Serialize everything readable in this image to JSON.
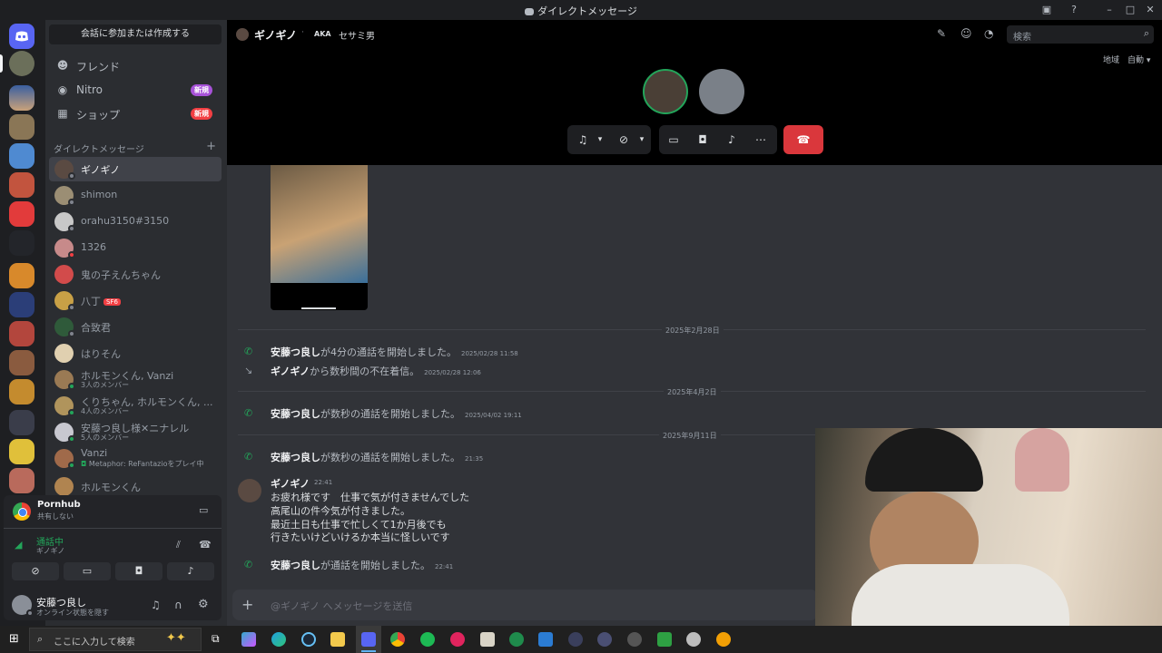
{
  "window": {
    "title": "ダイレクトメッセージ"
  },
  "sidebar": {
    "find_conversation": "会話に参加または作成する",
    "nav": [
      {
        "label": "フレンド"
      },
      {
        "label": "Nitro",
        "badge": "新規"
      },
      {
        "label": "ショップ",
        "badge": "新規"
      }
    ],
    "dm_header": "ダイレクトメッセージ",
    "dm_add": "+",
    "dms": [
      {
        "name": "ギノギノ"
      },
      {
        "name": "shimon"
      },
      {
        "name": "orahu3150#3150"
      },
      {
        "name": "1326"
      },
      {
        "name": "鬼の子えんちゃん"
      },
      {
        "name": "八丁",
        "tag": "SF6"
      },
      {
        "name": "合致君"
      },
      {
        "name": "はりそん"
      },
      {
        "name": "ホルモンくん, Vanzi",
        "sub": "3人のメンバー"
      },
      {
        "name": "くりちゃん, ホルモンくん, ...",
        "sub": "4人のメンバー"
      },
      {
        "name": "安藤つ良し様✕ニナレル",
        "sub": "5人のメンバー"
      },
      {
        "name": "Vanzi",
        "sub": "Metaphor: ReFantazioをプレイ中"
      },
      {
        "name": "ホルモンくん"
      }
    ]
  },
  "share": {
    "app": "Pornhub",
    "app_status": "共有しない",
    "call_status": "通話中",
    "call_with": "ギノギノ"
  },
  "user": {
    "name": "安藤つ良し",
    "status": "オンライン状態を隠す"
  },
  "header": {
    "channel_name": "ギノギノ",
    "aka_label": "AKA",
    "aka_name": "セサミ男",
    "search_placeholder": "検索",
    "region_label": "地域",
    "region_value": "自動"
  },
  "chat": {
    "date1": "2025年2月28日",
    "date2": "2025年4月2日",
    "date3": "2025年9月11日",
    "sys": [
      {
        "who": "安藤つ良し",
        "text": "が4分の通話を開始しました。",
        "ts": "2025/02/28 11:58"
      },
      {
        "who": "ギノギノ",
        "text": "から数秒間の不在着信。",
        "ts": "2025/02/28 12:06"
      },
      {
        "who": "安藤つ良し",
        "text": "が数秒の通話を開始しました。",
        "ts": "2025/04/02 19:11"
      },
      {
        "who": "安藤つ良し",
        "text": "が数秒の通話を開始しました。",
        "ts": "21:35"
      },
      {
        "who": "安藤つ良し",
        "text": "が通話を開始しました。",
        "ts": "22:41"
      }
    ],
    "message": {
      "author": "ギノギノ",
      "ts": "22:41",
      "lines": [
        "お疲れ様です　仕事で気が付きませんでした",
        "高尾山の件今気が付きました。",
        "最近土日も仕事で忙しくて1か月後でも",
        "行きたいけどいけるか本当に怪しいです"
      ]
    },
    "composer_placeholder": "@ギノギノ へメッセージを送信"
  },
  "taskbar": {
    "search_placeholder": "ここに入力して検索"
  },
  "colors": {
    "accent": "#5865f2",
    "hangup": "#da373c",
    "online": "#23a55a"
  }
}
